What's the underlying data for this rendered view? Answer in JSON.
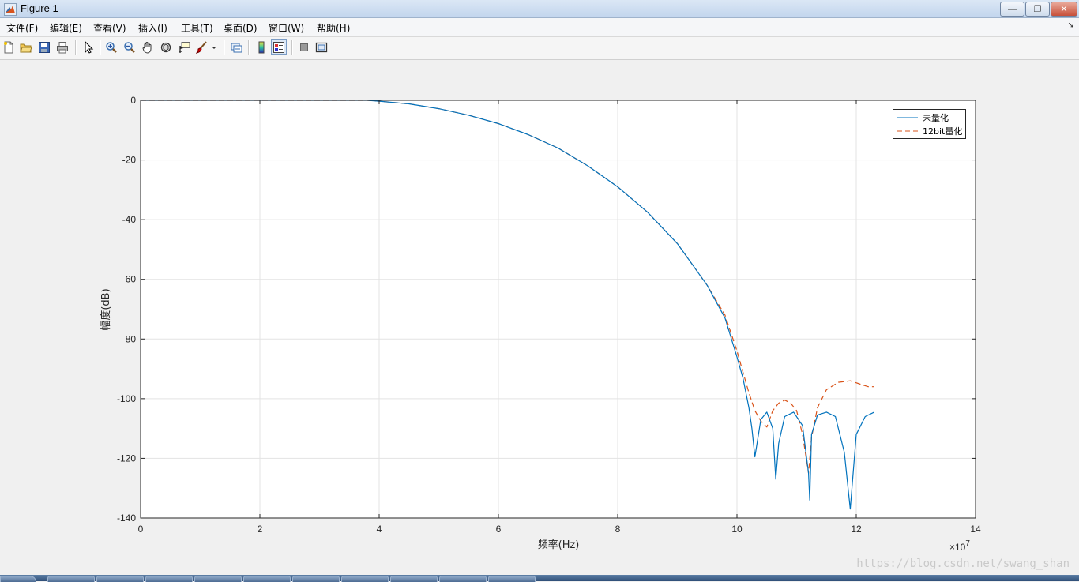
{
  "window": {
    "title": "Figure 1",
    "buttons": {
      "minimize": "—",
      "restore": "❐",
      "close": "✕"
    }
  },
  "menubar": {
    "items": [
      "文件(F)",
      "编辑(E)",
      "查看(V)",
      "插入(I)",
      "工具(T)",
      "桌面(D)",
      "窗口(W)",
      "帮助(H)"
    ],
    "overflow_icon": "arrow-icon"
  },
  "toolbar": {
    "buttons": [
      {
        "name": "new-figure-icon"
      },
      {
        "name": "open-file-icon"
      },
      {
        "name": "save-icon"
      },
      {
        "name": "print-icon"
      },
      {
        "name": "edit-plot-arrow-icon"
      },
      {
        "name": "zoom-in-icon"
      },
      {
        "name": "zoom-out-icon"
      },
      {
        "name": "pan-hand-icon"
      },
      {
        "name": "rotate-3d-icon"
      },
      {
        "name": "data-cursor-icon"
      },
      {
        "name": "brush-icon"
      },
      {
        "name": "link-plot-icon"
      },
      {
        "name": "insert-colorbar-icon"
      },
      {
        "name": "insert-legend-icon"
      },
      {
        "name": "hide-plot-tools-icon"
      },
      {
        "name": "show-plot-tools-icon"
      }
    ]
  },
  "chart_data": {
    "type": "line",
    "title": "",
    "xlabel": "频率(Hz)",
    "ylabel": "幅度(dB)",
    "x_exponent_label": "×10",
    "x_exponent_power": "7",
    "xlim": [
      0,
      14
    ],
    "ylim": [
      -140,
      0
    ],
    "xticks": [
      0,
      2,
      4,
      6,
      8,
      10,
      12,
      14
    ],
    "yticks": [
      0,
      -20,
      -40,
      -60,
      -80,
      -100,
      -120,
      -140
    ],
    "grid": true,
    "legend_position": "top-right",
    "series": [
      {
        "name": "未量化",
        "color": "#0072bd",
        "style": "solid",
        "x": [
          0,
          1,
          2,
          3,
          3.8,
          4,
          4.5,
          5,
          5.5,
          6,
          6.5,
          7,
          7.5,
          8,
          8.5,
          9,
          9.5,
          9.8,
          10,
          10.1,
          10.2,
          10.25,
          10.3,
          10.4,
          10.5,
          10.6,
          10.65,
          10.7,
          10.8,
          10.95,
          11.1,
          11.2,
          11.22,
          11.25,
          11.35,
          11.5,
          11.65,
          11.8,
          11.9,
          12.0,
          12.15,
          12.3
        ],
        "y": [
          0,
          0,
          0,
          0,
          0,
          -0.3,
          -1.2,
          -2.8,
          -5,
          -7.8,
          -11.5,
          -16,
          -22,
          -29,
          -37.5,
          -48,
          -62,
          -73,
          -86,
          -93,
          -103,
          -110,
          -119.5,
          -107,
          -104.5,
          -110,
          -127,
          -115,
          -106,
          -104.5,
          -109,
          -125,
          -134,
          -112,
          -105.5,
          -104.5,
          -106,
          -118,
          -137,
          -112,
          -106,
          -104.5
        ]
      },
      {
        "name": "12bit量化",
        "color": "#d95319",
        "style": "dashed",
        "x": [
          0,
          1,
          2,
          3,
          3.8,
          4,
          4.5,
          5,
          5.5,
          6,
          6.5,
          7,
          7.5,
          8,
          8.5,
          9,
          9.5,
          9.8,
          10,
          10.1,
          10.2,
          10.3,
          10.4,
          10.5,
          10.6,
          10.7,
          10.8,
          10.9,
          11.0,
          11.1,
          11.2,
          11.25,
          11.35,
          11.5,
          11.7,
          11.9,
          12.05,
          12.2,
          12.3
        ],
        "y": [
          0,
          0,
          0,
          0,
          0,
          -0.3,
          -1.2,
          -2.8,
          -5,
          -7.8,
          -11.5,
          -16,
          -22,
          -29,
          -37.5,
          -48,
          -62,
          -72,
          -84,
          -91,
          -98,
          -104,
          -107.5,
          -109.5,
          -104,
          -101.5,
          -100.5,
          -101.5,
          -104,
          -112,
          -125,
          -113,
          -103,
          -97,
          -94.5,
          -94,
          -95,
          -96,
          -96
        ]
      }
    ]
  },
  "watermark": "https://blog.csdn.net/swang_shan"
}
